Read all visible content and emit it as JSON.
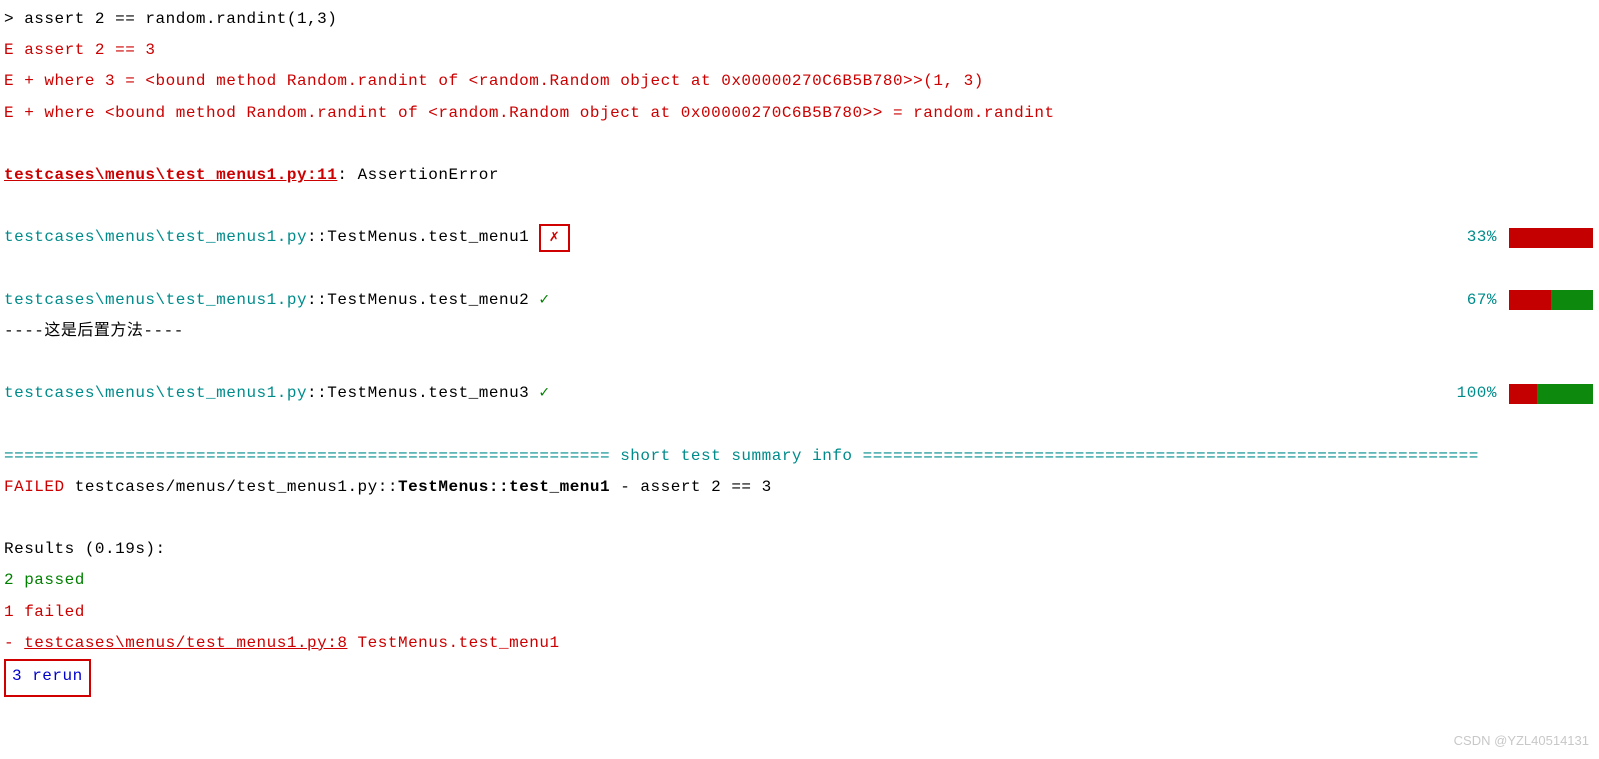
{
  "trace": {
    "l1": ">       assert 2 == random.randint(1,3)",
    "l2": "E       assert 2 == 3",
    "l3": "E        +  where 3 = <bound method Random.randint of <random.Random object at 0x00000270C6B5B780>>(1, 3)",
    "l4": "E        +    where <bound method Random.randint of <random.Random object at 0x00000270C6B5B780>> = random.randint"
  },
  "loc": {
    "file": "testcases\\menus\\test_menus1.py:11",
    "err": ": AssertionError"
  },
  "tests": [
    {
      "path": " testcases\\menus\\test_menus1.py",
      "node": "::TestMenus.test_menu1 ",
      "mark": "✗",
      "markClass": "red",
      "boxed": true,
      "percent": "33%",
      "bar": [
        "r",
        "r",
        "r"
      ]
    },
    {
      "path": " testcases\\menus\\test_menus1.py",
      "node": "::TestMenus.test_menu2 ",
      "mark": "✓",
      "markClass": "green",
      "boxed": false,
      "percent": "67%",
      "bar": [
        "r",
        "r",
        "r",
        "g",
        "g",
        "g"
      ]
    },
    {
      "path": " testcases\\menus\\test_menus1.py",
      "node": "::TestMenus.test_menu3 ",
      "mark": "✓",
      "markClass": "green",
      "boxed": false,
      "percent": "100%",
      "bar": [
        "r",
        "r",
        "r",
        "g",
        "g",
        "g",
        "g",
        "g",
        "g"
      ]
    }
  ],
  "teardown": "----这是后置方法----",
  "summary_header": "============================================================ short test summary info =============================================================",
  "summary": {
    "failed_label": "FAILED",
    "failed_path": " testcases/menus/test_menus1.py::",
    "failed_node": "TestMenus::test_menu1",
    "failed_tail": " - assert 2 == 3"
  },
  "results": {
    "header": "Results (0.19s):",
    "passed": "       2 passed",
    "failed": "       1 failed",
    "failed_dash": "         - ",
    "failed_link": "testcases\\menus/test_menus1.py:8",
    "failed_name": " TestMenus.test_menu1",
    "rerun": "       3 rerun"
  },
  "watermark": "CSDN @YZL40514131"
}
